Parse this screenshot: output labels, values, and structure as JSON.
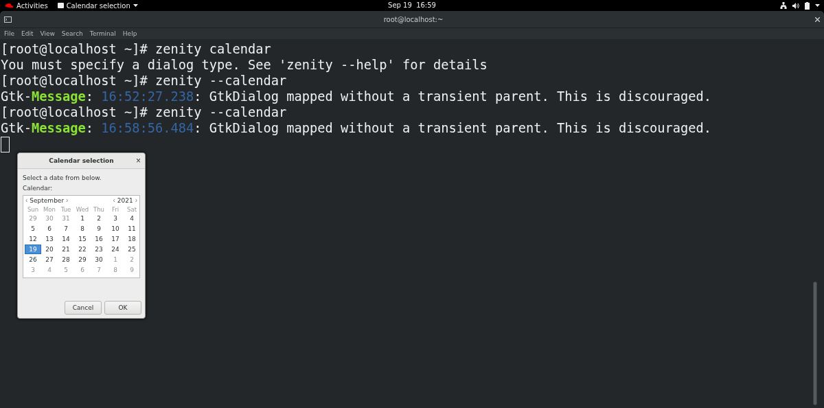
{
  "top_bar": {
    "activities": "Activities",
    "app_menu": "Calendar selection",
    "clock": "Sep 19  16:59"
  },
  "window": {
    "title": "root@localhost:~"
  },
  "menu": [
    "File",
    "Edit",
    "View",
    "Search",
    "Terminal",
    "Help"
  ],
  "terminal_lines": [
    [
      {
        "text": "[root@localhost ~]# zenity calendar",
        "kind": "plain"
      }
    ],
    [
      {
        "text": "You must specify a dialog type. See 'zenity --help' for details",
        "kind": "plain"
      }
    ],
    [
      {
        "text": "[root@localhost ~]# zenity --calendar",
        "kind": "plain"
      }
    ],
    [
      {
        "text": "Gtk-",
        "kind": "plain"
      },
      {
        "text": "Message",
        "kind": "green"
      },
      {
        "text": ": ",
        "kind": "plain"
      },
      {
        "text": "16:52:27.238",
        "kind": "blue"
      },
      {
        "text": ": GtkDialog mapped without a transient parent. This is discouraged.",
        "kind": "plain"
      }
    ],
    [
      {
        "text": "[root@localhost ~]# zenity --calendar",
        "kind": "plain"
      }
    ],
    [
      {
        "text": "Gtk-",
        "kind": "plain"
      },
      {
        "text": "Message",
        "kind": "green"
      },
      {
        "text": ": ",
        "kind": "plain"
      },
      {
        "text": "16:58:56.484",
        "kind": "blue"
      },
      {
        "text": ": GtkDialog mapped without a transient parent. This is discouraged.",
        "kind": "plain"
      }
    ]
  ],
  "dialog": {
    "title": "Calendar selection",
    "close": "×",
    "prompt": "Select a date from below.",
    "label": "Calendar:",
    "month": "September",
    "year": "2021",
    "prev": "‹",
    "next": "›",
    "weekdays": [
      "Sun",
      "Mon",
      "Tue",
      "Wed",
      "Thu",
      "Fri",
      "Sat"
    ],
    "weeks": [
      [
        {
          "day": "29",
          "muted": true,
          "selected": false
        },
        {
          "day": "30",
          "muted": true,
          "selected": false
        },
        {
          "day": "31",
          "muted": true,
          "selected": false
        },
        {
          "day": "1",
          "muted": false,
          "selected": false
        },
        {
          "day": "2",
          "muted": false,
          "selected": false
        },
        {
          "day": "3",
          "muted": false,
          "selected": false
        },
        {
          "day": "4",
          "muted": false,
          "selected": false
        }
      ],
      [
        {
          "day": "5",
          "muted": false,
          "selected": false
        },
        {
          "day": "6",
          "muted": false,
          "selected": false
        },
        {
          "day": "7",
          "muted": false,
          "selected": false
        },
        {
          "day": "8",
          "muted": false,
          "selected": false
        },
        {
          "day": "9",
          "muted": false,
          "selected": false
        },
        {
          "day": "10",
          "muted": false,
          "selected": false
        },
        {
          "day": "11",
          "muted": false,
          "selected": false
        }
      ],
      [
        {
          "day": "12",
          "muted": false,
          "selected": false
        },
        {
          "day": "13",
          "muted": false,
          "selected": false
        },
        {
          "day": "14",
          "muted": false,
          "selected": false
        },
        {
          "day": "15",
          "muted": false,
          "selected": false
        },
        {
          "day": "16",
          "muted": false,
          "selected": false
        },
        {
          "day": "17",
          "muted": false,
          "selected": false
        },
        {
          "day": "18",
          "muted": false,
          "selected": false
        }
      ],
      [
        {
          "day": "19",
          "muted": false,
          "selected": true
        },
        {
          "day": "20",
          "muted": false,
          "selected": false
        },
        {
          "day": "21",
          "muted": false,
          "selected": false
        },
        {
          "day": "22",
          "muted": false,
          "selected": false
        },
        {
          "day": "23",
          "muted": false,
          "selected": false
        },
        {
          "day": "24",
          "muted": false,
          "selected": false
        },
        {
          "day": "25",
          "muted": false,
          "selected": false
        }
      ],
      [
        {
          "day": "26",
          "muted": false,
          "selected": false
        },
        {
          "day": "27",
          "muted": false,
          "selected": false
        },
        {
          "day": "28",
          "muted": false,
          "selected": false
        },
        {
          "day": "29",
          "muted": false,
          "selected": false
        },
        {
          "day": "30",
          "muted": false,
          "selected": false
        },
        {
          "day": "1",
          "muted": true,
          "selected": false
        },
        {
          "day": "2",
          "muted": true,
          "selected": false
        }
      ],
      [
        {
          "day": "3",
          "muted": true,
          "selected": false
        },
        {
          "day": "4",
          "muted": true,
          "selected": false
        },
        {
          "day": "5",
          "muted": true,
          "selected": false
        },
        {
          "day": "6",
          "muted": true,
          "selected": false
        },
        {
          "day": "7",
          "muted": true,
          "selected": false
        },
        {
          "day": "8",
          "muted": true,
          "selected": false
        },
        {
          "day": "9",
          "muted": true,
          "selected": false
        }
      ]
    ],
    "buttons": [
      "Cancel",
      "OK"
    ]
  }
}
